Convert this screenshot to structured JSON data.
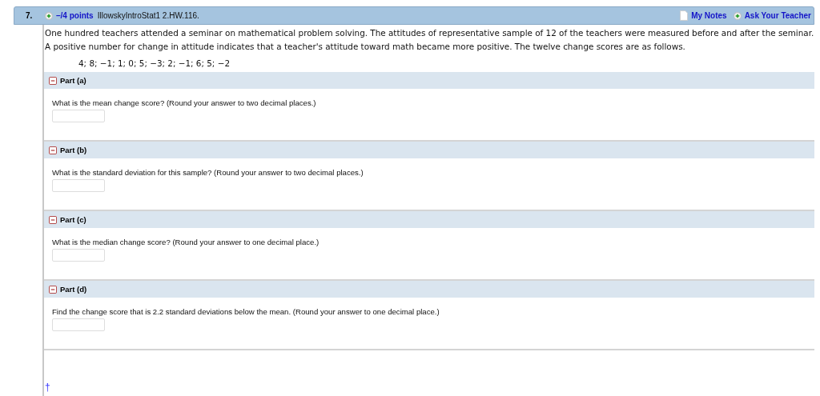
{
  "question": {
    "number": "7.",
    "points": "–/4 points",
    "source": "IllowskyIntroStat1 2.HW.116.",
    "links": [
      "My Notes",
      "Ask Your Teacher"
    ]
  },
  "intro": "One hundred teachers attended a seminar on mathematical problem solving. The attitudes of representative sample of 12 of the teachers were measured before and after the seminar. A positive number for change in attitude indicates that a teacher's attitude toward math became more positive. The twelve change scores are as follows.",
  "scores": "4; 8; −1; 1; 0; 5; −3; 2; −1; 6; 5; −2",
  "parts": [
    {
      "label": "Part (a)",
      "expanded": true,
      "prompt": "What is the mean change score? (Round your answer to two decimal places.)"
    },
    {
      "label": "Part (b)",
      "expanded": true,
      "prompt": "What is the standard deviation for this sample? (Round your answer to two decimal places.)"
    },
    {
      "label": "Part (c)",
      "expanded": true,
      "prompt": "What is the median change score? (Round your answer to one decimal place.)"
    },
    {
      "label": "Part (d)",
      "expanded": true,
      "prompt": "Find the change score that is 2.2 standard deviations below the mean. (Round your answer to one decimal place.)"
    }
  ],
  "footnote": "†"
}
